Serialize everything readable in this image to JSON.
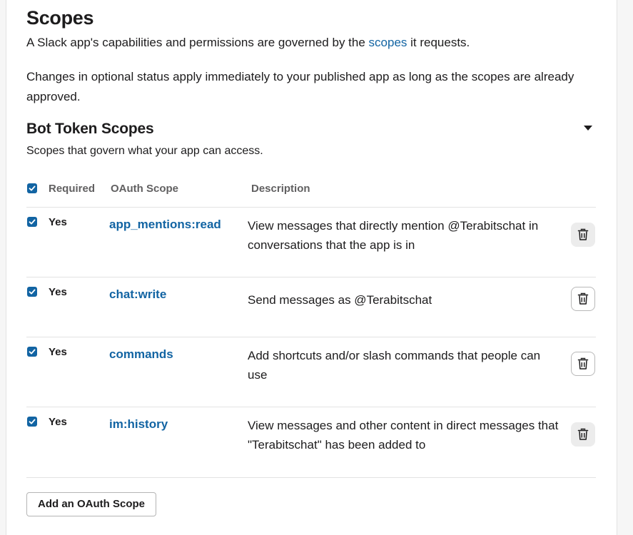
{
  "header": {
    "title": "Scopes",
    "intro_before": "A Slack app's capabilities and permissions are governed by the ",
    "intro_link": "scopes",
    "intro_after": " it requests.",
    "notice": "Changes in optional status apply immediately to your published app as long as the scopes are already approved."
  },
  "bot_section": {
    "title": "Bot Token Scopes",
    "subtitle": "Scopes that govern what your app can access."
  },
  "table": {
    "headers": {
      "required": "Required",
      "scope": "OAuth Scope",
      "description": "Description"
    },
    "rows": [
      {
        "required": "Yes",
        "scope": "app_mentions:read",
        "description": "View messages that directly mention @Terabitschat in conversations that the app is in"
      },
      {
        "required": "Yes",
        "scope": "chat:write",
        "description": "Send messages as @Terabitschat"
      },
      {
        "required": "Yes",
        "scope": "commands",
        "description": "Add shortcuts and/or slash commands that people can use"
      },
      {
        "required": "Yes",
        "scope": "im:history",
        "description": "View messages and other content in direct messages that \"Terabitschat\" has been added to"
      }
    ]
  },
  "actions": {
    "add_scope_label": "Add an OAuth Scope"
  },
  "colors": {
    "link": "#1264a3",
    "checkbox": "#1264a3",
    "text": "#1d1c1d"
  },
  "icons": {
    "collapse": "caret-down-icon",
    "remove": "trash-icon",
    "checked": "checkmark-icon"
  }
}
